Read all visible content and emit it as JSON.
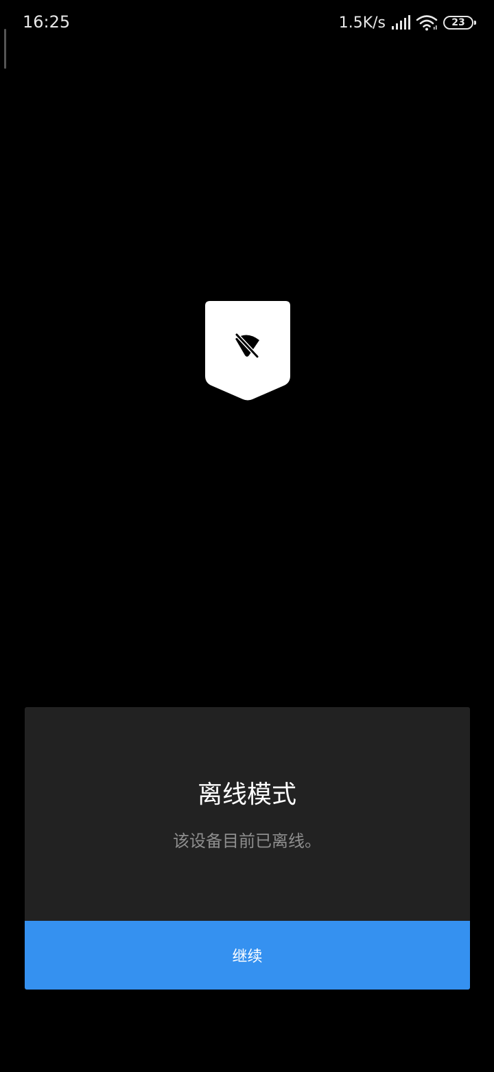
{
  "status_bar": {
    "time": "16:25",
    "network_speed": "1.5K/s",
    "battery_level": "23",
    "icons": [
      "signal-bars-icon",
      "wifi-icon",
      "battery-icon"
    ]
  },
  "badge": {
    "icon": "wifi-off-icon"
  },
  "dialog": {
    "title": "离线模式",
    "message": "该设备目前已离线。",
    "continue_label": "继续"
  },
  "colors": {
    "background": "#000000",
    "card_background": "#222222",
    "primary_button": "#3591f0",
    "message_text": "#8e8e8e",
    "badge_fill": "#ffffff"
  }
}
